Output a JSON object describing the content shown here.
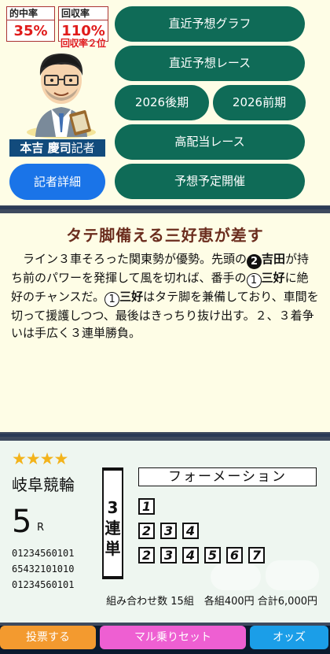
{
  "stats": {
    "hit_rate_label": "的中率",
    "hit_rate_value": "35%",
    "recovery_label": "回収率",
    "recovery_value": "110%",
    "recovery_rank": "回収率２位"
  },
  "reporter": {
    "name": "本吉 慶司",
    "title": "記者",
    "detail_button": "記者詳細"
  },
  "menu": {
    "graph": "直近予想グラフ",
    "races": "直近予想レース",
    "later": "2026後期",
    "earlier": "2026前期",
    "high_payout": "高配当レース",
    "schedule": "予想予定開催"
  },
  "comment": {
    "headline": "タテ脚備える三好恵が差す",
    "p1": "ライン３車そろった関東勢が優勢。先頭の",
    "n2": "2",
    "yoshida": "吉田",
    "p2": "が持ち前のパワーを発揮して風を切れば、番手の",
    "n1a": "1",
    "miyoshi_a": "三好",
    "p3": "に絶好のチャンスだ。",
    "n1b": "1",
    "miyoshi_b": "三好",
    "p4": "はタテ脚を兼備しており、車間を切って援護しつつ、最後はきっちり抜け出す。２、３着争いは手広く３連単勝負。"
  },
  "bet": {
    "stars": "★★★★",
    "venue": "岐阜競輪",
    "race_number": "5",
    "race_unit": "R",
    "codes": [
      "01234560101",
      "65432101010",
      "01234560101"
    ],
    "bet_type": [
      "3",
      "連",
      "単"
    ],
    "formation_label": "フォーメーション",
    "rows": [
      [
        "1"
      ],
      [
        "2",
        "3",
        "4"
      ],
      [
        "2",
        "3",
        "4",
        "5",
        "6",
        "7"
      ]
    ],
    "summary": "組み合わせ数 15組　各組400円 合計6,000円"
  },
  "actions": {
    "vote": "投票する",
    "set": "マル乗りセット",
    "odds": "オッズ"
  },
  "colors": {
    "green_button": "#0f6b57",
    "blue_button": "#1a74e8",
    "vote": "#f39a2f",
    "set": "#ee5fd2",
    "odds": "#1b9ee8"
  }
}
